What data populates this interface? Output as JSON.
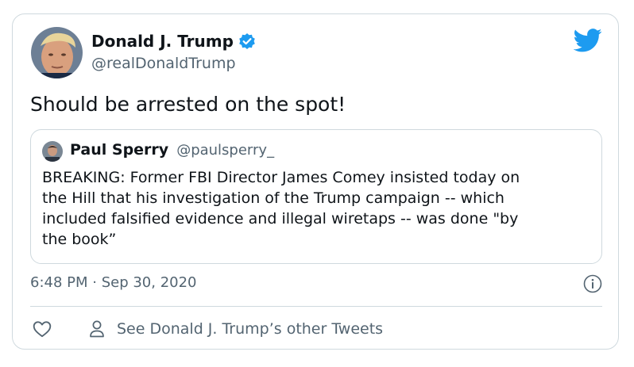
{
  "author": {
    "display_name": "Donald J. Trump",
    "handle": "@realDonaldTrump",
    "verified": true
  },
  "tweet": {
    "text": "Should be arrested on the spot!",
    "timestamp": "6:48 PM · Sep 30, 2020"
  },
  "quoted_tweet": {
    "display_name": "Paul Sperry",
    "handle": "@paulsperry_",
    "text": "BREAKING: Former FBI Director James Comey insisted today on\nthe Hill that his investigation of the Trump campaign -- which\nincluded falsified evidence and illegal wiretaps -- was done \"by\nthe book”"
  },
  "actions": {
    "see_more": "See Donald J. Trump’s other Tweets"
  },
  "icons": {
    "verified": "verified-badge-icon",
    "brand": "twitter-bird-icon",
    "info": "info-icon",
    "like": "heart-icon",
    "profile": "person-icon"
  },
  "colors": {
    "brand": "#1d9bf0",
    "text": "#0f1419",
    "muted": "#536471",
    "border": "#cfd9de"
  }
}
